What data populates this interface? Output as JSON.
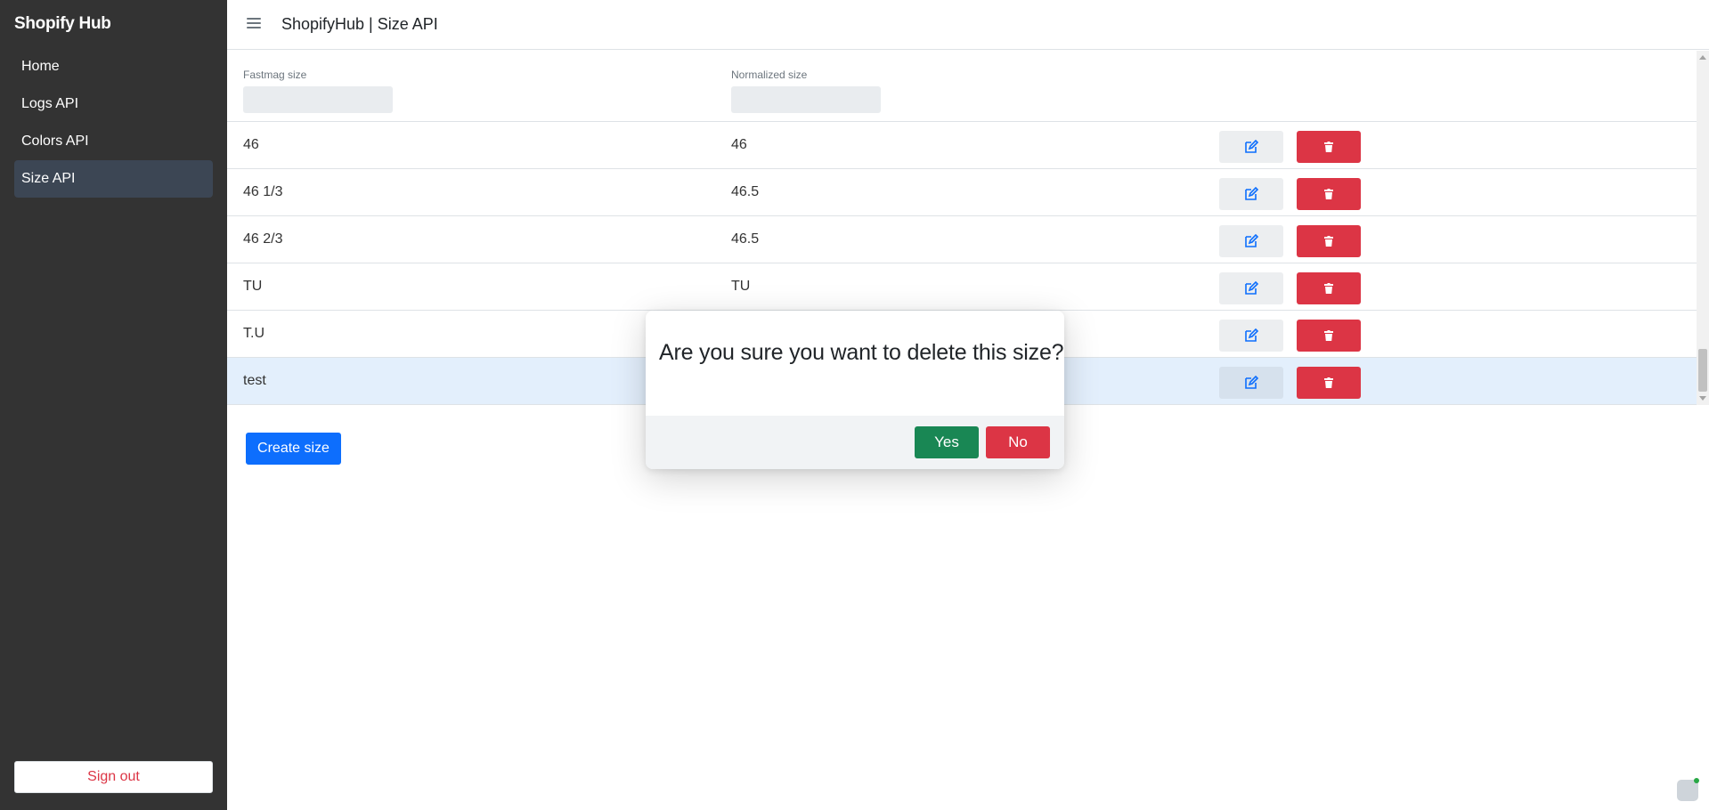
{
  "sidebar": {
    "brand": "Shopify Hub",
    "items": [
      {
        "label": "Home"
      },
      {
        "label": "Logs API"
      },
      {
        "label": "Colors API"
      },
      {
        "label": "Size API"
      }
    ],
    "signout_label": "Sign out"
  },
  "header": {
    "title": "ShopifyHub | Size API",
    "menu_icon": "hamburger-icon"
  },
  "table": {
    "columns": [
      "Fastmag size",
      "Normalized size"
    ],
    "filters": [
      "",
      ""
    ],
    "rows": [
      {
        "fastmag": "46",
        "normalized": "46"
      },
      {
        "fastmag": "46 1/3",
        "normalized": "46.5"
      },
      {
        "fastmag": "46 2/3",
        "normalized": "46.5"
      },
      {
        "fastmag": "TU",
        "normalized": "TU"
      },
      {
        "fastmag": "T.U",
        "normalized": ""
      },
      {
        "fastmag": "test",
        "normalized": ""
      }
    ],
    "selected_row": 5,
    "edit_icon": "edit-icon",
    "delete_icon": "trash-icon"
  },
  "create_button_label": "Create size",
  "modal": {
    "message": "Are you sure you want to delete this size?",
    "yes_label": "Yes",
    "no_label": "No"
  },
  "colors": {
    "sidebar_bg": "#333333",
    "active_item_bg": "#3c4654",
    "primary": "#0d6efd",
    "danger": "#dc3545",
    "success": "#198754",
    "selected_row_bg": "#e3effc"
  }
}
